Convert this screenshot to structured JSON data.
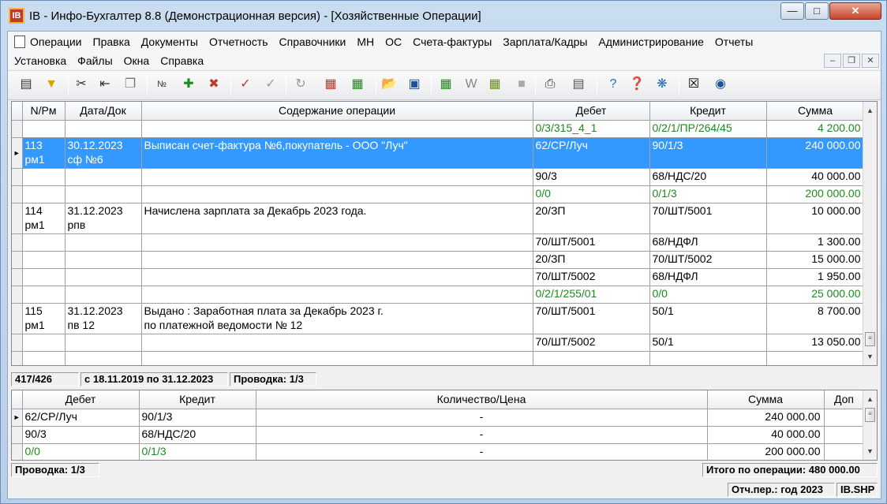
{
  "window": {
    "title": "IB - Инфо-Бухгалтер 8.8 (Демонстрационная версия) - [Хозяйственные Операции]",
    "app_icon_text": "IB"
  },
  "menu": {
    "row1": [
      "Операции",
      "Правка",
      "Документы",
      "Отчетность",
      "Справочники",
      "МН",
      "ОС",
      "Счета-фактуры",
      "Зарплата/Кадры",
      "Администрирование",
      "Отчеты"
    ],
    "row2": [
      "Установка",
      "Файлы",
      "Окна",
      "Справка"
    ]
  },
  "toolbar_icons": [
    "journal-icon",
    "filter-icon",
    "cut-icon",
    "move-icon",
    "copy-icon",
    "numbering-icon",
    "add-icon",
    "delete-icon",
    "mark-icon",
    "unmark-icon",
    "refresh-icon",
    "calendar-icon",
    "calculator-icon",
    "open-icon",
    "save-icon",
    "excel-icon",
    "word-icon",
    "report-icon",
    "disabled-icon",
    "print-icon",
    "preview-icon",
    "help-icon",
    "context-help-icon",
    "compass-icon",
    "close-doc-icon",
    "web-icon"
  ],
  "main_grid": {
    "headers": [
      "N/Рм",
      "Дата/Док",
      "Содержание операции",
      "Дебет",
      "Кредит",
      "Сумма"
    ],
    "rows": [
      {
        "num": "",
        "date": "",
        "content": "",
        "debit": "0/3/315_4_1",
        "credit": "0/2/1/ПР/264/45",
        "sum": "4 200.00",
        "green": true,
        "selected": false,
        "tall": false
      },
      {
        "num": "113\nрм1",
        "date": "30.12.2023\nсф №6",
        "content": "Выписан счет-фактура №6,покупатель - ООО \"Луч\"",
        "debit": "62/СР/Луч",
        "credit": "90/1/3",
        "sum": "240 000.00",
        "green": false,
        "selected": true,
        "tall": true
      },
      {
        "num": "",
        "date": "",
        "content": "",
        "debit": "90/3",
        "credit": "68/НДС/20",
        "sum": "40 000.00",
        "green": false,
        "selected": false,
        "tall": false
      },
      {
        "num": "",
        "date": "",
        "content": "",
        "debit": "0/0",
        "credit": "0/1/3",
        "sum": "200 000.00",
        "green": true,
        "selected": false,
        "tall": false
      },
      {
        "num": "114\nрм1",
        "date": "31.12.2023\nрпв",
        "content": "Начислена зарплата за Декабрь 2023 года.",
        "debit": "20/ЗП",
        "credit": "70/ШТ/5001",
        "sum": "10 000.00",
        "green": false,
        "selected": false,
        "tall": true
      },
      {
        "num": "",
        "date": "",
        "content": "",
        "debit": "70/ШТ/5001",
        "credit": "68/НДФЛ",
        "sum": "1 300.00",
        "green": false,
        "selected": false,
        "tall": false
      },
      {
        "num": "",
        "date": "",
        "content": "",
        "debit": "20/ЗП",
        "credit": "70/ШТ/5002",
        "sum": "15 000.00",
        "green": false,
        "selected": false,
        "tall": false
      },
      {
        "num": "",
        "date": "",
        "content": "",
        "debit": "70/ШТ/5002",
        "credit": "68/НДФЛ",
        "sum": "1 950.00",
        "green": false,
        "selected": false,
        "tall": false
      },
      {
        "num": "",
        "date": "",
        "content": "",
        "debit": "0/2/1/255/01",
        "credit": "0/0",
        "sum": "25 000.00",
        "green": true,
        "selected": false,
        "tall": false
      },
      {
        "num": "115\nрм1",
        "date": "31.12.2023\nпв 12",
        "content": "Выдано : Заработная плата за Декабрь 2023 г.\nпо платежной ведомости № 12",
        "debit": "70/ШТ/5001",
        "credit": "50/1",
        "sum": "8 700.00",
        "green": false,
        "selected": false,
        "tall": true
      },
      {
        "num": "",
        "date": "",
        "content": "",
        "debit": "70/ШТ/5002",
        "credit": "50/1",
        "sum": "13 050.00",
        "green": false,
        "selected": false,
        "tall": false
      }
    ]
  },
  "status_top": {
    "counter": "417/426",
    "period": "с 18.11.2019 по 31.12.2023",
    "posting": "Проводка: 1/3"
  },
  "sub_grid": {
    "headers": [
      "Дебет",
      "Кредит",
      "Количество/Цена",
      "Сумма",
      "Доп"
    ],
    "rows": [
      {
        "debit": "62/СР/Луч",
        "credit": "90/1/3",
        "qty": "-",
        "sum": "240 000.00",
        "extra": "",
        "green": false,
        "current": true
      },
      {
        "debit": "90/3",
        "credit": "68/НДС/20",
        "qty": "-",
        "sum": "40 000.00",
        "extra": "",
        "green": false,
        "current": false
      },
      {
        "debit": "0/0",
        "credit": "0/1/3",
        "qty": "-",
        "sum": "200 000.00",
        "extra": "",
        "green": true,
        "current": false
      }
    ]
  },
  "status_bottom": {
    "posting": "Проводка: 1/3",
    "total": "Итого по операции: 480 000.00"
  },
  "status_footer": {
    "period": "Отч.пер.: год 2023",
    "file": "IB.SHP"
  },
  "colors": {
    "selection": "#3399ff",
    "green_text": "#1e8a1e"
  }
}
